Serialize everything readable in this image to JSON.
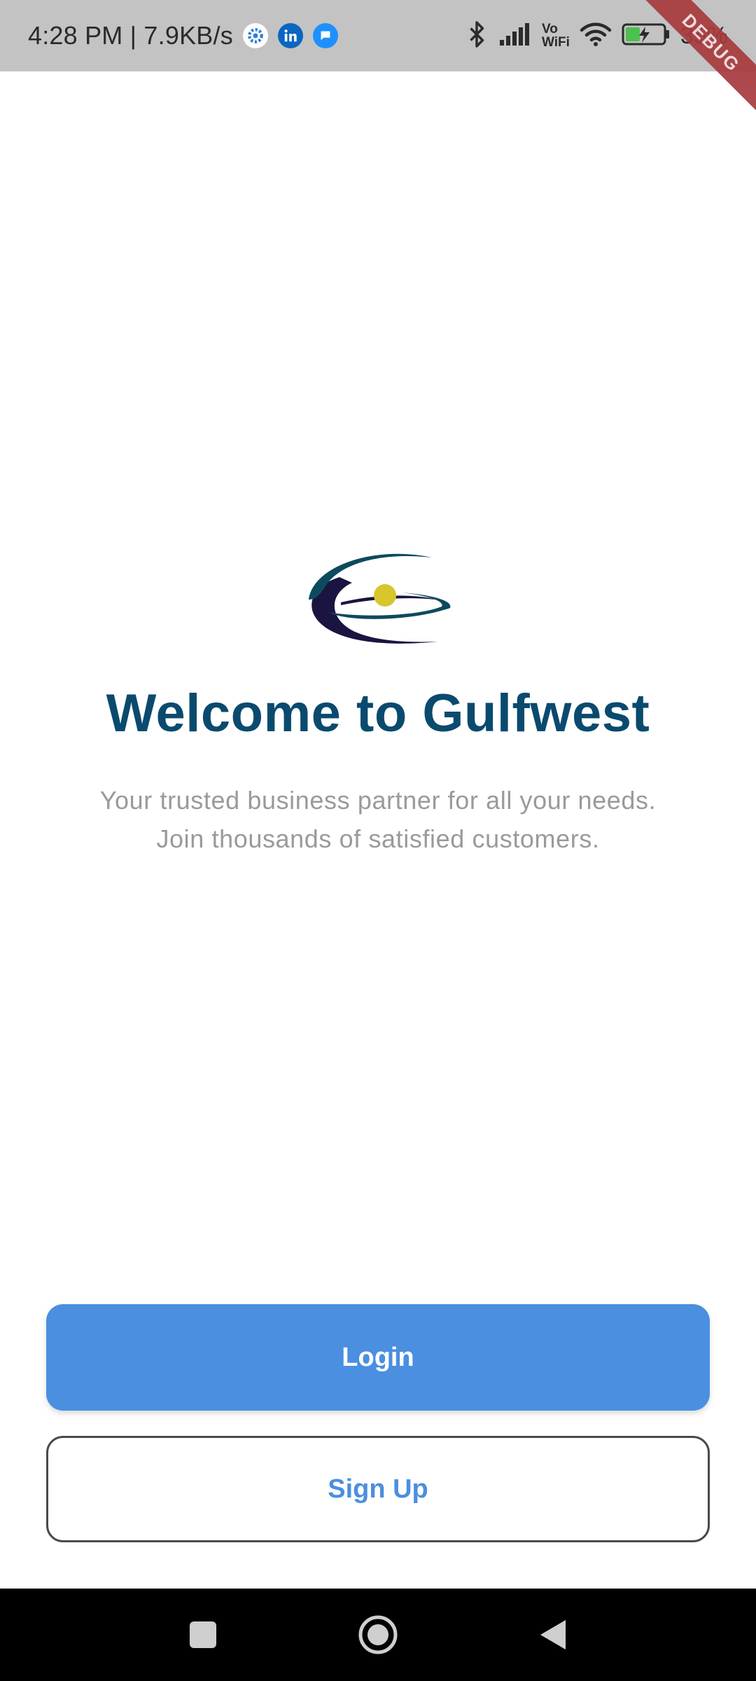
{
  "status_bar": {
    "time_speed": "4:28 PM | 7.9KB/s",
    "vo_label": "Vo",
    "wifi_label": "WiFi",
    "battery_percent": "35%",
    "notification_icons": [
      "settings-gear-icon",
      "linkedin-icon",
      "messages-icon"
    ],
    "system_icons": [
      "bluetooth-icon",
      "signal-icon",
      "vowifi-icon",
      "wifi-icon",
      "battery-charging-icon"
    ]
  },
  "debug_banner": {
    "label": "DEBUG"
  },
  "welcome": {
    "title": "Welcome to Gulfwest",
    "subtitle_line1": "Your trusted business partner for all your needs.",
    "subtitle_line2": "Join thousands of satisfied customers."
  },
  "actions": {
    "login_label": "Login",
    "signup_label": "Sign Up"
  },
  "nav_bar": {
    "icons": [
      "recents-square-icon",
      "home-circle-icon",
      "back-triangle-icon"
    ]
  },
  "colors": {
    "title": "#0a4a6e",
    "subtitle": "#9a9a9a",
    "primary_button": "#4a8fe0",
    "status_bar_bg": "#c3c3c3",
    "logo_navy": "#1a1440",
    "logo_teal": "#0e4a5e",
    "logo_dot": "#d8c62c",
    "debug_ribbon": "#a73a3d"
  }
}
